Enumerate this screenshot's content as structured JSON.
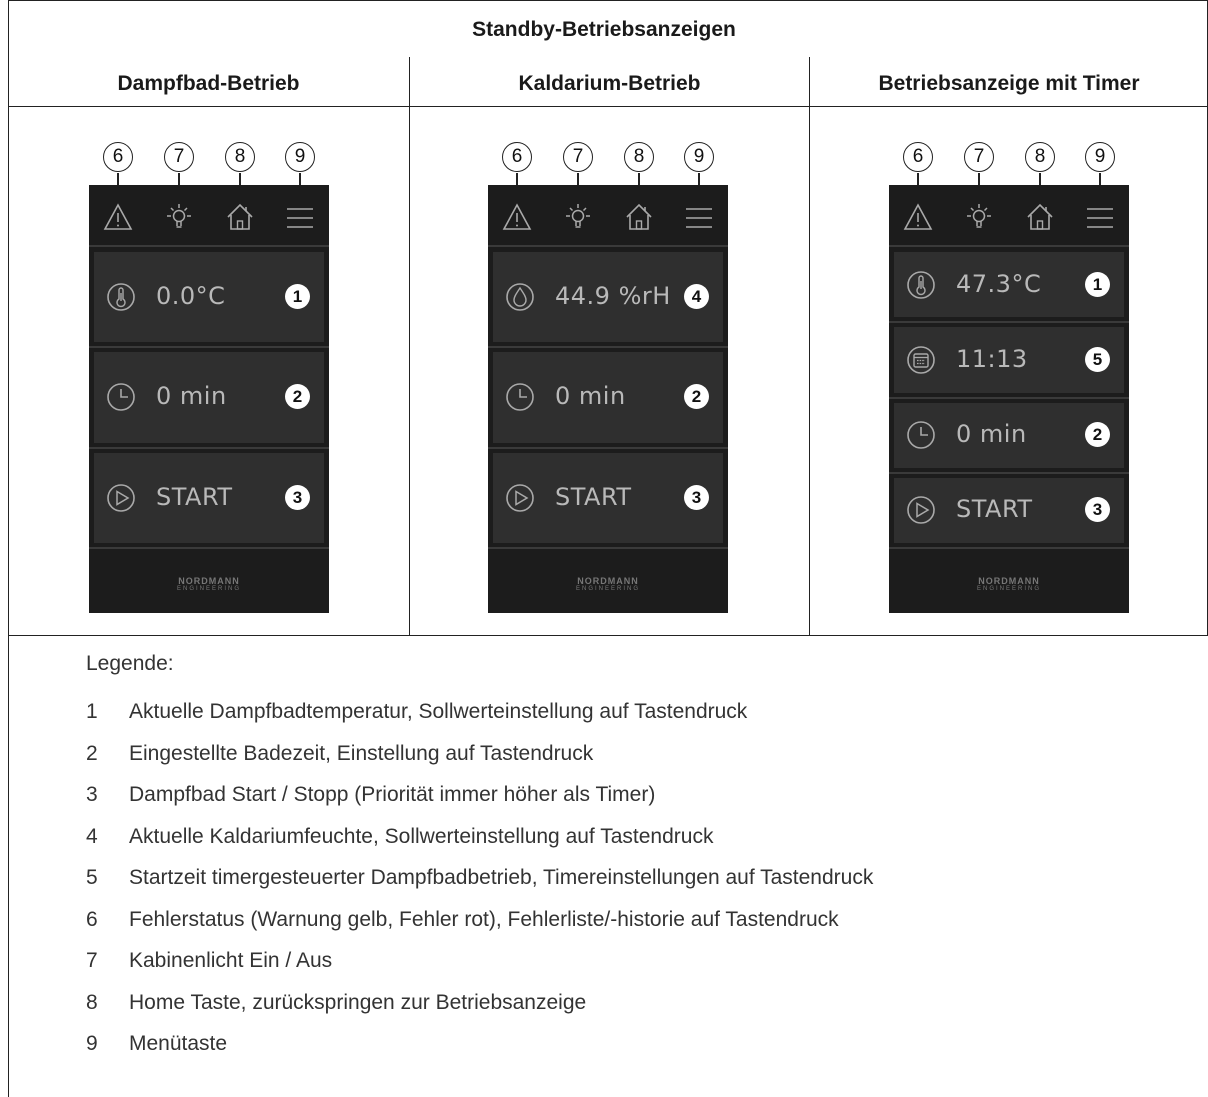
{
  "title": "Standby-Betriebsanzeigen",
  "columns": [
    "Dampfbad-Betrieb",
    "Kaldarium-Betrieb",
    "Betriebsanzeige mit Timer"
  ],
  "callouts": [
    "6",
    "7",
    "8",
    "9"
  ],
  "brand": {
    "name": "NORDMANN",
    "sub": "ENGINEERING"
  },
  "screens": [
    {
      "tiles": [
        {
          "icon": "thermometer-icon",
          "value": "0.0°C",
          "badge": "1"
        },
        {
          "icon": "clock-icon",
          "value": "0 min",
          "badge": "2"
        },
        {
          "icon": "play-icon",
          "value": "START",
          "badge": "3"
        }
      ]
    },
    {
      "tiles": [
        {
          "icon": "droplet-icon",
          "value": "44.9 %rH",
          "badge": "4"
        },
        {
          "icon": "clock-icon",
          "value": "0 min",
          "badge": "2"
        },
        {
          "icon": "play-icon",
          "value": "START",
          "badge": "3"
        }
      ]
    },
    {
      "tiles": [
        {
          "icon": "thermometer-icon",
          "value": "47.3°C",
          "badge": "1"
        },
        {
          "icon": "calendar-icon",
          "value": "11:13",
          "badge": "5"
        },
        {
          "icon": "clock-icon",
          "value": "0 min",
          "badge": "2"
        },
        {
          "icon": "play-icon",
          "value": "START",
          "badge": "3"
        }
      ]
    }
  ],
  "topbar_icons": [
    "warning-icon",
    "light-bulb-icon",
    "home-icon",
    "menu-icon"
  ],
  "legend": {
    "heading": "Legende:",
    "items": [
      {
        "num": "1",
        "text": "Aktuelle Dampfbadtemperatur, Sollwerteinstellung auf Tastendruck"
      },
      {
        "num": "2",
        "text": "Eingestellte Badezeit, Einstellung auf Tastendruck"
      },
      {
        "num": "3",
        "text": "Dampfbad Start / Stopp (Priorität immer höher als Timer)"
      },
      {
        "num": "4",
        "text": "Aktuelle Kaldariumfeuchte, Sollwerteinstellung auf Tastendruck"
      },
      {
        "num": "5",
        "text": "Startzeit timergesteuerter Dampfbadbetrieb, Timereinstellungen auf Tastendruck"
      },
      {
        "num": "6",
        "text": "Fehlerstatus (Warnung gelb, Fehler rot), Fehlerliste/-historie auf Tastendruck"
      },
      {
        "num": "7",
        "text": "Kabinenlicht Ein / Aus"
      },
      {
        "num": "8",
        "text": "Home Taste, zurückspringen zur Betriebsanzeige"
      },
      {
        "num": "9",
        "text": "Menütaste"
      }
    ]
  }
}
